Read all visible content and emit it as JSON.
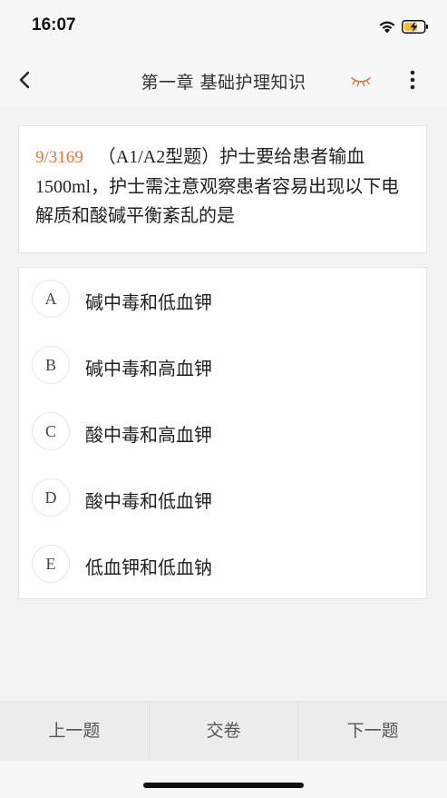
{
  "status_bar": {
    "time": "16:07"
  },
  "nav": {
    "title": "第一章 基础护理知识"
  },
  "question": {
    "number": "9/3169",
    "text": "（A1/A2型题）护士要给患者输血1500ml，护士需注意观察患者容易出现以下电解质和酸碱平衡紊乱的是"
  },
  "options": [
    {
      "letter": "A",
      "text": "碱中毒和低血钾"
    },
    {
      "letter": "B",
      "text": "碱中毒和高血钾"
    },
    {
      "letter": "C",
      "text": "酸中毒和高血钾"
    },
    {
      "letter": "D",
      "text": "酸中毒和低血钾"
    },
    {
      "letter": "E",
      "text": "低血钾和低血钠"
    }
  ],
  "bottom_bar": {
    "prev_label": "上一题",
    "submit_label": "交卷",
    "next_label": "下一题"
  },
  "colors": {
    "accent": "#e8753a",
    "battery": "#f5c518"
  },
  "icons": {
    "signal": "wifi-icon",
    "battery": "battery-charging-icon",
    "back": "chevron-left-icon",
    "eye": "eye-closed-icon",
    "more": "more-vertical-icon"
  }
}
